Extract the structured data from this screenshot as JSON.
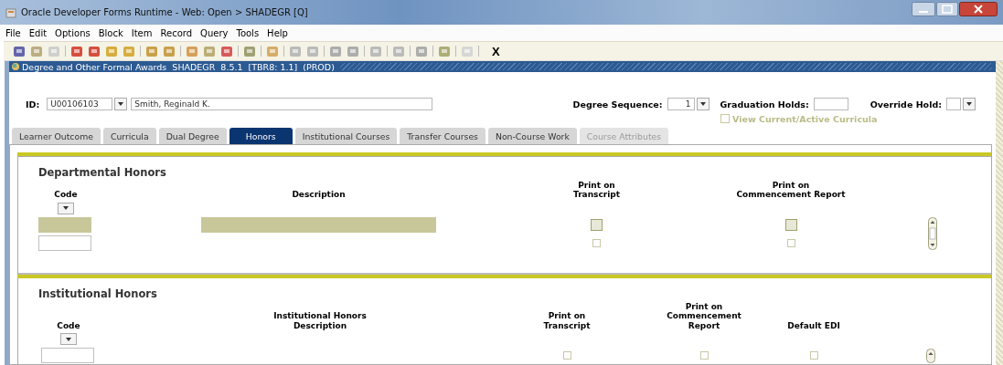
{
  "window": {
    "title": "Oracle Developer Forms Runtime - Web: Open > SHADEGR [Q]"
  },
  "menu": [
    "File",
    "Edit",
    "Options",
    "Block",
    "Item",
    "Record",
    "Query",
    "Tools",
    "Help"
  ],
  "toolbar": {
    "exit": "X"
  },
  "form": {
    "title": "Degree and Other Formal Awards  SHADEGR  8.5.1  [TBR8: 1.1]  (PROD)"
  },
  "key_block": {
    "id_label": "ID:",
    "id": "U00106103",
    "name": "Smith, Reginald K.",
    "seq_label": "Degree Sequence:",
    "seq": "1",
    "holds_label": "Graduation Holds:",
    "override_label": "Override Hold:",
    "view_current": {
      "label": "View Current/Active Curricula",
      "checked": false,
      "disabled": true
    }
  },
  "tabs": [
    {
      "label": "Learner Outcome",
      "selected": false,
      "disabled": false
    },
    {
      "label": "Curricula",
      "selected": false,
      "disabled": false
    },
    {
      "label": "Dual Degree",
      "selected": false,
      "disabled": false
    },
    {
      "label": "Honors",
      "selected": true,
      "disabled": false
    },
    {
      "label": "Institutional Courses",
      "selected": false,
      "disabled": false
    },
    {
      "label": "Transfer Courses",
      "selected": false,
      "disabled": false
    },
    {
      "label": "Non-Course Work",
      "selected": false,
      "disabled": false
    },
    {
      "label": "Course Attributes",
      "selected": false,
      "disabled": true
    }
  ],
  "departmental": {
    "title": "Departmental Honors",
    "columns": [
      "Code",
      "Description",
      "Print on\nTranscript",
      "Print on\nCommencement Report"
    ],
    "rows": [
      {
        "current": true,
        "print_transcript": false,
        "print_commencement": false
      },
      {
        "current": false,
        "print_transcript": false,
        "print_commencement": false
      }
    ]
  },
  "institutional": {
    "title": "Institutional Honors",
    "columns": [
      "Code",
      "Institutional Honors\nDescription",
      "Print on\nTranscript",
      "Print on\nCommencement\nReport",
      "Default EDI"
    ],
    "rows": [
      {
        "current": false,
        "print_transcript": false,
        "print_commencement": false,
        "default_edi": false
      }
    ]
  }
}
